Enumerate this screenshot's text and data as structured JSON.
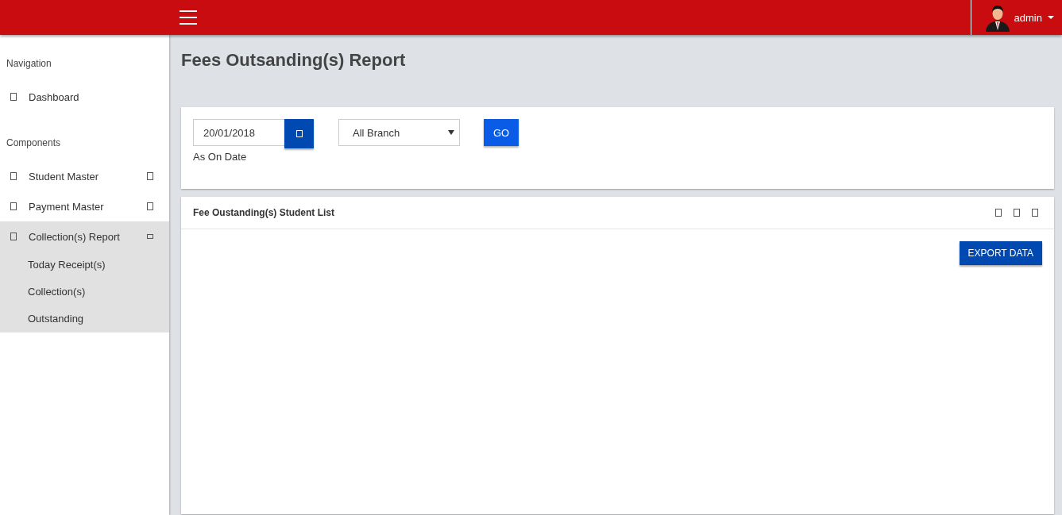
{
  "top_bar": {
    "user": "admin"
  },
  "sidebar": {
    "sections": [
      {
        "heading": "Navigation",
        "items": [
          {
            "label": "Dashboard",
            "expandable": false,
            "expanded": false
          }
        ]
      },
      {
        "heading": "Components",
        "items": [
          {
            "label": "Student Master",
            "expandable": true,
            "expanded": false
          },
          {
            "label": "Payment Master",
            "expandable": true,
            "expanded": false
          },
          {
            "label": "Collection(s) Report",
            "expandable": true,
            "expanded": true,
            "children": [
              {
                "label": "Today Receipt(s)"
              },
              {
                "label": "Collection(s)"
              },
              {
                "label": "Outstanding"
              }
            ]
          }
        ]
      }
    ]
  },
  "page": {
    "title": "Fees Outsanding(s) Report"
  },
  "filter": {
    "date": {
      "value": "20/01/2018",
      "label": "As On Date"
    },
    "branch": {
      "value": "All Branch"
    },
    "go_button": "GO"
  },
  "list_panel": {
    "title": "Fee Oustanding(s) Student List",
    "export_button": "EXPORT DATA"
  }
}
